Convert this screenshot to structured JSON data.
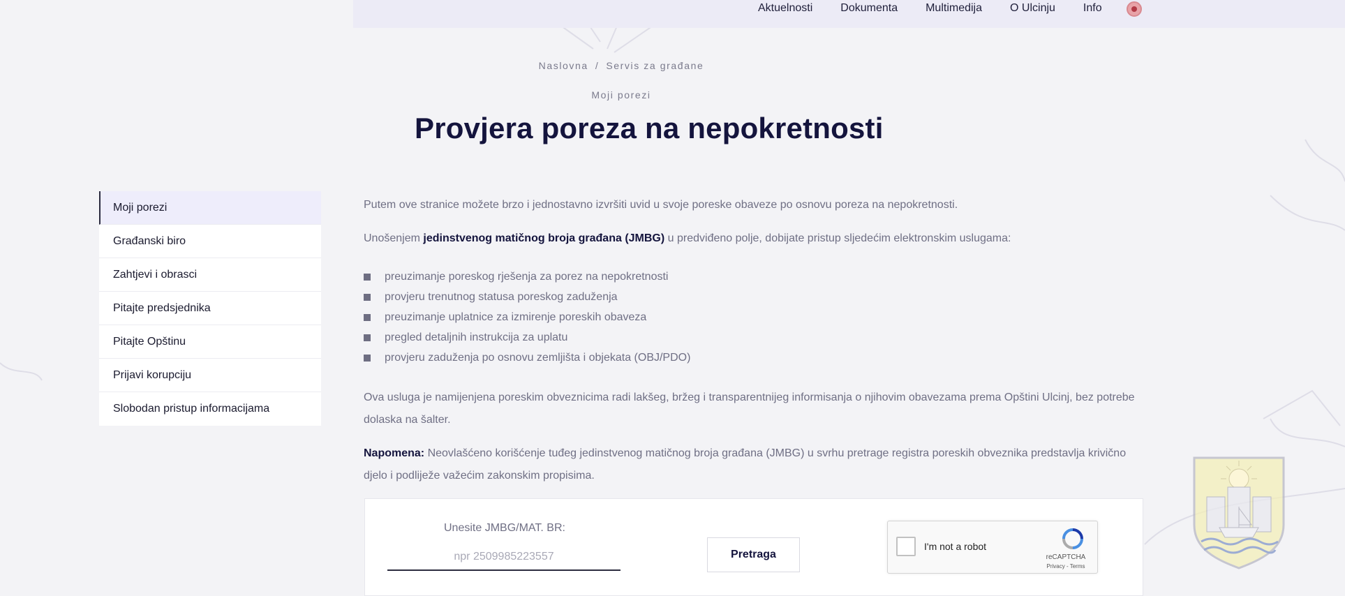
{
  "nav": {
    "items": [
      "Aktuelnosti",
      "Dokumenta",
      "Multimedija",
      "O Ulcinju",
      "Info"
    ],
    "language_icon": "flag-albania-icon"
  },
  "breadcrumb": {
    "home": "Naslovna",
    "separator": "/",
    "current": "Servis za građane"
  },
  "page": {
    "eyebrow": "Moji porezi",
    "title": "Provjera poreza na nepokretnosti"
  },
  "sidebar": {
    "items": [
      "Moji porezi",
      "Građanski biro",
      "Zahtjevi i obrasci",
      "Pitajte predsjednika",
      "Pitajte Opštinu",
      "Prijavi korupciju",
      "Slobodan pristup informacijama"
    ],
    "active_index": 0
  },
  "content": {
    "intro": "Putem ove stranice možete brzo i jednostavno izvršiti uvid u svoje poreske obaveze po osnovu poreza na nepokretnosti.",
    "jmbg_pre": "Unošenjem ",
    "jmbg_bold": "jedinstvenog matičnog broja građana (JMBG)",
    "jmbg_post": " u predviđeno polje, dobijate pristup sljedećim elektronskim uslugama:",
    "services": [
      "preuzimanje poreskog rješenja za porez na nepokretnosti",
      "provjeru trenutnog statusa poreskog zaduženja",
      "preuzimanje uplatnice za izmirenje poreskih obaveza",
      "pregled detaljnih instrukcija za uplatu",
      "provjeru zaduženja po osnovu zemljišta i objekata (OBJ/PDO)"
    ],
    "purpose": "Ova usluga je namijenjena poreskim obveznicima radi lakšeg, bržeg i transparentnijeg informisanja o njihovim obavezama prema Opštini Ulcinj, bez potrebe dolaska na šalter.",
    "note_label": "Napomena:",
    "note_text": " Neovlašćeno korišćenje tuđeg jedinstvenog matičnog broja građana (JMBG) u svrhu pretrage registra poreskih obveznika predstavlja krivično djelo i podliježe važećim zakonskim propisima."
  },
  "search": {
    "label": "Unesite JMBG/MAT. BR:",
    "value": "",
    "placeholder": "npr 2509985223557",
    "button": "Pretraga"
  },
  "recaptcha": {
    "label": "I'm not a robot",
    "brand": "reCAPTCHA",
    "terms": "Privacy - Terms"
  },
  "colors": {
    "title": "#14143d",
    "text": "#6f6f84",
    "topbar": "#ecebf6",
    "sidebar_active": "#eeedfb",
    "background": "#f3f3f6"
  }
}
